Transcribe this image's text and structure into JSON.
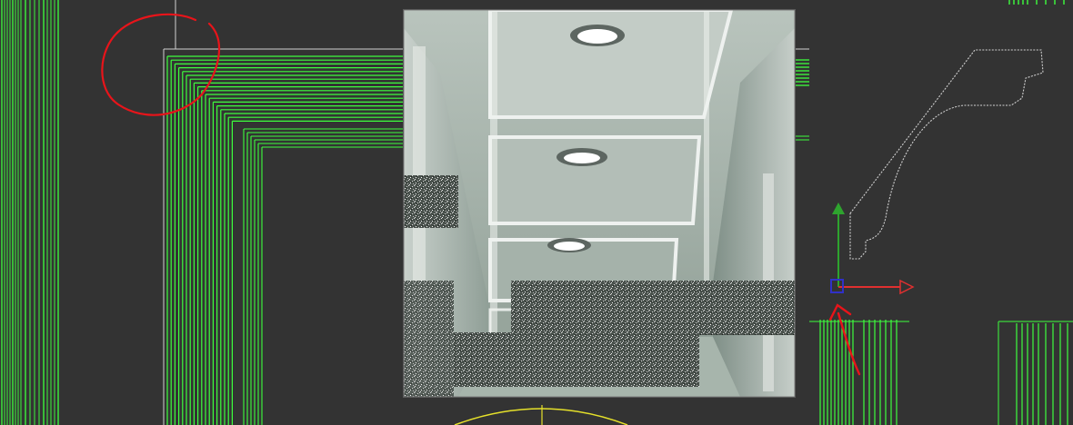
{
  "viewport": {
    "background": "#333333",
    "line_color": "#3dff3d",
    "guide_color": "#d0d0d0",
    "annotation_color": "#e8141a",
    "gizmo_x_color": "#e03030",
    "gizmo_y_color": "#2ea42e",
    "gizmo_z_color": "#3030c8",
    "arc_color": "#e6e12a"
  },
  "render_preview": {
    "tint": "#9fb0a6",
    "light_color": "#ffffff"
  },
  "icons": {
    "annotation_circle": "circle-annotation-icon",
    "annotation_arrow": "arrow-annotation-icon",
    "transform_gizmo": "move-gizmo-icon"
  }
}
